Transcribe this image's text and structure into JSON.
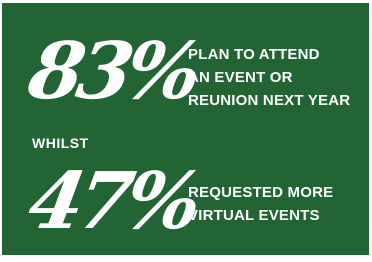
{
  "background_color": "#226434",
  "text_color": "#ffffff",
  "stats": [
    {
      "number": "83%",
      "lines": [
        "PLAN TO ATTEND",
        "AN EVENT OR",
        "REUNION NEXT YEAR"
      ]
    },
    {
      "number": "47%",
      "lines": [
        "REQUESTED MORE",
        "VIRTUAL EVENTS"
      ]
    }
  ],
  "connector": "WHILST"
}
